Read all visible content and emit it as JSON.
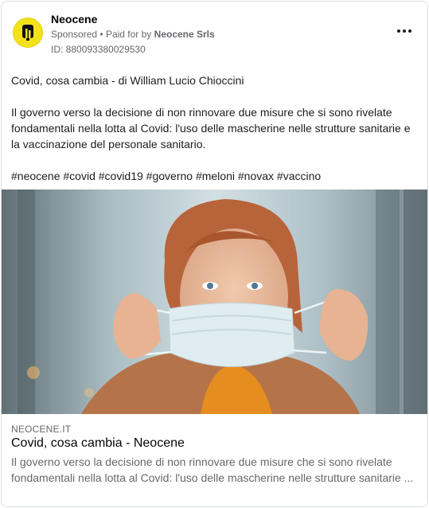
{
  "ad": {
    "page_name": "Neocene",
    "sponsored_label": "Sponsored",
    "separator": "•",
    "paid_for_prefix": "Paid for by",
    "paid_for_name": "Neocene Srls",
    "ad_id": "ID: 880093380029530",
    "avatar_icon": "neocene-logo-icon",
    "more_icon": "more-options-icon"
  },
  "post": {
    "title_line": "Covid, cosa cambia - di William Lucio Chioccini",
    "description": "Il governo verso la decisione di non rinnovare due misure che si sono rivelate fondamentali nella lotta al Covid: l'uso delle mascherine nelle strutture sanitarie e la vaccinazione del personale sanitario.",
    "hashtags": "#neocene #covid #covid19 #governo #meloni #novax #vaccino"
  },
  "link_preview": {
    "domain": "NEOCENE.IT",
    "title": "Covid, cosa cambia - Neocene",
    "description": "Il governo verso la decisione di non rinnovare due misure che si sono rivelate fondamentali nella lotta al Covid: l'uso delle mascherine nelle strutture sanitarie ..."
  },
  "colors": {
    "brand_yellow": "#f3e21a",
    "secondary_text": "#65676b",
    "border": "#dadde1"
  }
}
